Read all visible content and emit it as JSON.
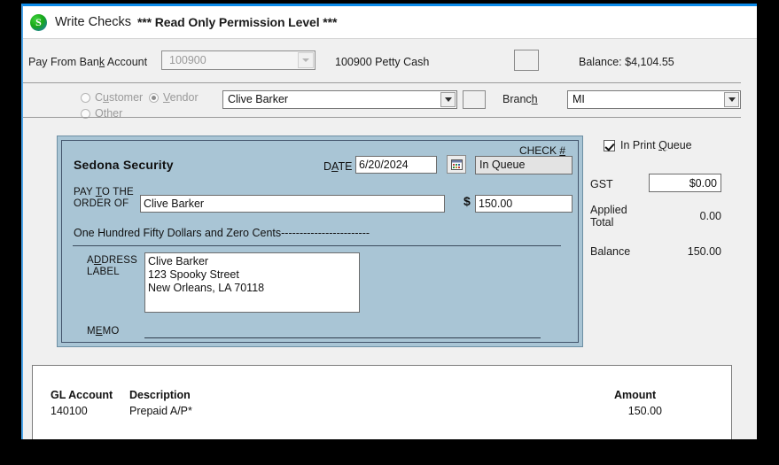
{
  "window": {
    "app_icon": "sedona-s-icon",
    "title": "Write Checks",
    "readonly_banner": "*** Read Only Permission Level ***"
  },
  "header": {
    "pay_from_label_pre": "Pay From Ban",
    "pay_from_label_accel": "k",
    "pay_from_label_post": " Account",
    "bank_account_value": "100900",
    "bank_account_name": "100900 Petty Cash",
    "balance_text": "Balance: $4,104.55"
  },
  "payee_type": {
    "customer_pre": "C",
    "customer_accel": "u",
    "customer_post": "stomer",
    "vendor_pre": "",
    "vendor_accel": "V",
    "vendor_post": "endor",
    "other": "Other",
    "selected": "Vendor"
  },
  "vendor": {
    "value": "Clive Barker"
  },
  "branch": {
    "label_pre": "Branc",
    "label_accel": "h",
    "value": "MI"
  },
  "check": {
    "company_name": "Sedona Security",
    "date_label_pre": "D",
    "date_label_accel": "A",
    "date_label_post": "TE",
    "date_value": "6/20/2024",
    "calendar_icon": "calendar-icon",
    "check_number_label_pre": "CHECK ",
    "check_number_label_accel": "#",
    "check_number_value": "In Queue",
    "pay_to_line1_pre": "PAY ",
    "pay_to_line1_accel": "T",
    "pay_to_line1_post": "O THE",
    "pay_to_line2": "ORDER OF",
    "payee_value": "Clive Barker",
    "currency_symbol": "$",
    "amount_value": "150.00",
    "amount_words": "One Hundred Fifty Dollars and Zero Cents------------------------",
    "address_label_pre": "A",
    "address_label_accel": "D",
    "address_label_post": "DRESS",
    "address_label_line2": "LABEL",
    "address_value": "Clive Barker\n123 Spooky Street\nNew Orleans, LA  70118",
    "memo_label_pre": "M",
    "memo_label_accel": "E",
    "memo_label_post": "MO",
    "memo_value": ""
  },
  "side_panel": {
    "print_queue_pre": "In Print ",
    "print_queue_accel": "Q",
    "print_queue_post": "ueue",
    "print_queue_checked": true,
    "gst_label": "GST",
    "gst_value": "$0.00",
    "applied_label_line1": "Applied",
    "applied_label_line2": "Total",
    "applied_value": "0.00",
    "balance_label": "Balance",
    "balance_value": "150.00"
  },
  "grid": {
    "columns": [
      "GL Account",
      "Description",
      "Amount"
    ],
    "rows": [
      {
        "gl_account": "140100",
        "description": "Prepaid A/P*",
        "amount": "150.00"
      }
    ]
  },
  "colors": {
    "check_bg": "#a9c5d5",
    "window_bg": "#f0f0f0",
    "accent_blue": "#0b8ae8",
    "frame_black": "#000000"
  }
}
